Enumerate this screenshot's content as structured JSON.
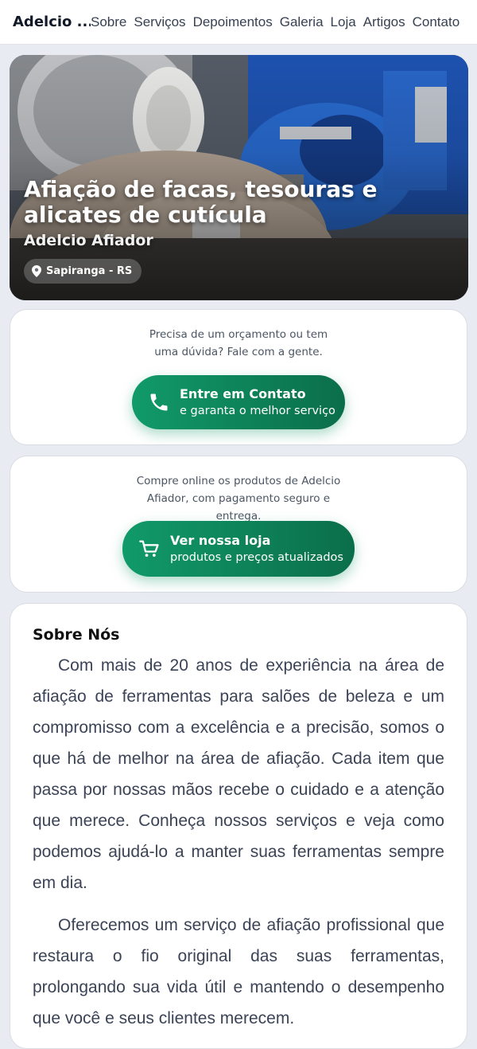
{
  "header": {
    "brand": "Adelcio ...",
    "nav": [
      "Sobre",
      "Serviços",
      "Depoimentos",
      "Galeria",
      "Loja",
      "Artigos",
      "Contato"
    ]
  },
  "hero": {
    "title": "Afiação de facas, tesouras e alicates de cutícula",
    "subtitle": "Adelcio Afiador",
    "location": "Sapiranga - RS"
  },
  "contact_card": {
    "text": "Precisa de um orçamento ou tem uma dúvida? Fale com a gente.",
    "button_title": "Entre em Contato",
    "button_subtitle": "e garanta o melhor serviço"
  },
  "shop_card": {
    "text": "Compre online os produtos de Adelcio Afiador, com pagamento seguro e entrega.",
    "button_title": "Ver nossa loja",
    "button_subtitle": "produtos e preços atualizados"
  },
  "about": {
    "heading": "Sobre Nós",
    "p1": "Com mais de 20 anos de experiência na área de afiação de ferramentas para salões de beleza e um compromisso com a excelência e a precisão, somos o que há de melhor na área de afiação. Cada item que passa por nossas mãos recebe o cuidado e a atenção que merece. Conheça nossos serviços e veja como podemos ajudá-lo a manter suas ferramentas sempre em dia.",
    "p2": "Oferecemos um serviço de afiação profissional que restaura o fio original das suas ferramentas, prolongando sua vida útil e mantendo o desempenho que você e seus clientes merecem."
  },
  "colors": {
    "accent_green": "#119a6a",
    "accent_green_dark": "#0b6e4a",
    "page_bg": "#e9ebf2"
  },
  "icons": {
    "location": "map-pin-icon",
    "contact": "phone-icon",
    "shop": "cart-icon"
  }
}
